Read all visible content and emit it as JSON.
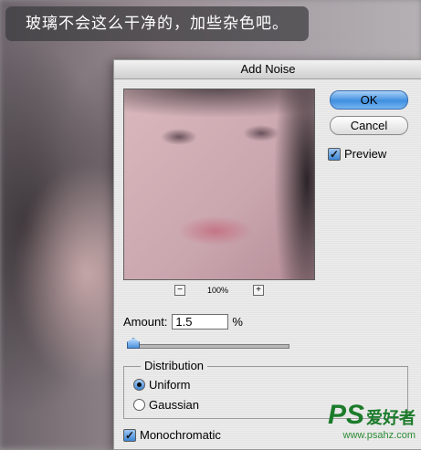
{
  "caption": "玻璃不会这么干净的，加些杂色吧。",
  "watermark": {
    "brand": "PS",
    "brand_cn": "爱好者",
    "url": "www.psahz.com"
  },
  "dialog": {
    "title": "Add Noise",
    "ok_label": "OK",
    "cancel_label": "Cancel",
    "preview_label": "Preview",
    "preview_checked": true,
    "zoom_level": "100%",
    "zoom_minus": "−",
    "zoom_plus": "+",
    "amount_label": "Amount:",
    "amount_value": "1.5",
    "amount_unit": "%",
    "distribution": {
      "legend": "Distribution",
      "options": [
        "Uniform",
        "Gaussian"
      ],
      "selected": "Uniform"
    },
    "monochromatic_label": "Monochromatic",
    "monochromatic_checked": true
  },
  "colors": {
    "ok_button": "#3f8fe0",
    "watermark": "#1b7b2a"
  },
  "icons": [
    "zoom-out-icon",
    "zoom-in-icon",
    "checkmark-icon",
    "radio-dot-icon",
    "slider-thumb-icon"
  ]
}
